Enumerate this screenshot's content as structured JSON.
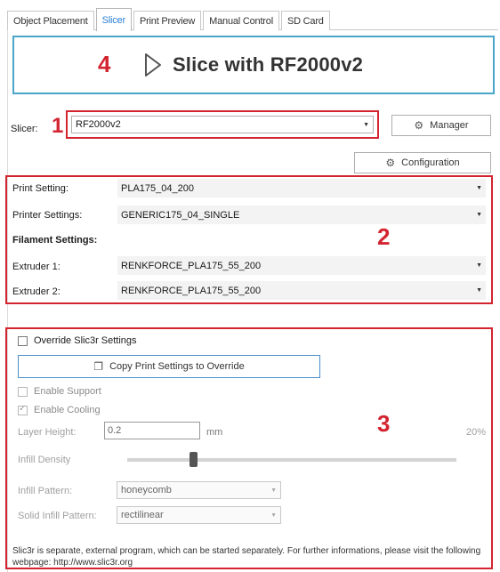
{
  "tabs": [
    {
      "label": "Object Placement",
      "active": false
    },
    {
      "label": "Slicer",
      "active": true
    },
    {
      "label": "Print Preview",
      "active": false
    },
    {
      "label": "Manual Control",
      "active": false
    },
    {
      "label": "SD Card",
      "active": false
    }
  ],
  "slice_button": {
    "label": "Slice with RF2000v2",
    "icon": "play-outline-icon"
  },
  "annotations": {
    "n1": "1",
    "n2": "2",
    "n3": "3",
    "n4": "4",
    "color": "#d32430"
  },
  "slicer": {
    "label": "Slicer:",
    "value": "RF2000v2"
  },
  "buttons": {
    "manager": "Manager",
    "configuration": "Configuration",
    "copy": "Copy Print Settings to Override"
  },
  "settings": {
    "print_label": "Print Setting:",
    "print_value": "PLA175_04_200",
    "printer_label": "Printer Settings:",
    "printer_value": "GENERIC175_04_SINGLE",
    "filament_heading": "Filament Settings:",
    "extruder1_label": "Extruder 1:",
    "extruder1_value": "RENKFORCE_PLA175_55_200",
    "extruder2_label": "Extruder 2:",
    "extruder2_value": "RENKFORCE_PLA175_55_200"
  },
  "override": {
    "override_label": "Override Slic3r Settings",
    "support_label": "Enable Support",
    "cooling_label": "Enable Cooling",
    "cooling_checked": true,
    "layer_height_label": "Layer Height:",
    "layer_height_value": "0.2",
    "layer_height_unit": "mm",
    "infill_percent": "20%",
    "infill_density_label": "Infill Density",
    "infill_fraction": 0.2,
    "infill_pattern_label": "Infill Pattern:",
    "infill_pattern_value": "honeycomb",
    "solid_pattern_label": "Solid Infill Pattern:",
    "solid_pattern_value": "rectilinear"
  },
  "footer": "Slic3r is separate, external program, which can be started separately. For further informations, please visit the following webpage: http://www.slic3r.org"
}
